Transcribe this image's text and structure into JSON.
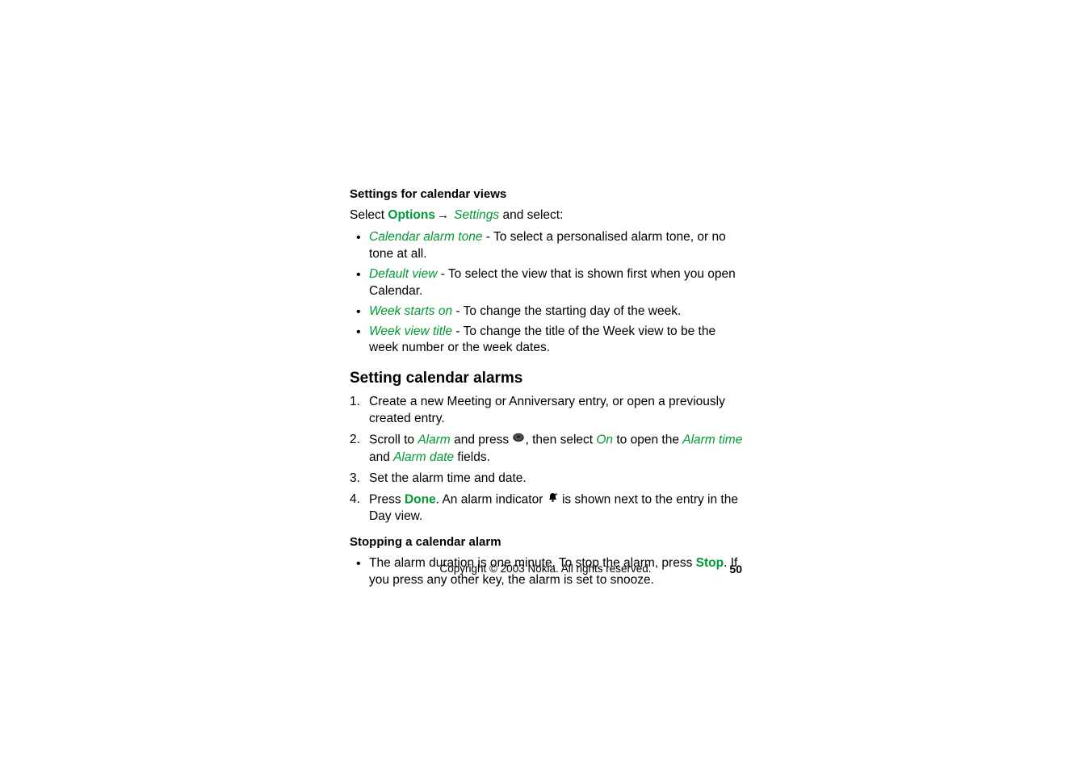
{
  "section1": {
    "heading": "Settings for calendar views",
    "select_prefix": "Select ",
    "options": "Options",
    "settings": "Settings",
    "and_select": " and select:",
    "items": [
      {
        "label": "Calendar alarm tone",
        "desc": " - To select a personalised alarm tone, or no tone at all."
      },
      {
        "label": "Default view",
        "desc": " - To select the view that is shown first when you open Calendar."
      },
      {
        "label": "Week starts on",
        "desc": " - To change the starting day of the week."
      },
      {
        "label": "Week view title",
        "desc": "  - To change the title of the Week view to be the week number or the week dates."
      }
    ]
  },
  "section2": {
    "heading": "Setting calendar alarms",
    "steps": {
      "s1": "Create a new Meeting or Anniversary entry, or open a previously created entry.",
      "s2_a": "Scroll to ",
      "s2_alarm": "Alarm",
      "s2_b": " and press ",
      "s2_c": ", then select ",
      "s2_on": "On",
      "s2_d": " to open the ",
      "s2_alarmtime": "Alarm time",
      "s2_e": " and ",
      "s2_alarmdate": "Alarm date",
      "s2_f": " fields.",
      "s3": "Set the alarm time and date.",
      "s4_a": "Press ",
      "s4_done": "Done",
      "s4_b": ". An alarm indicator ",
      "s4_c": " is shown next to the entry in the Day view."
    }
  },
  "section3": {
    "heading": "Stopping a calendar alarm",
    "bullet_a": "The alarm duration is one minute. To stop the alarm, press ",
    "bullet_stop": "Stop",
    "bullet_b": ". If you press any other key, the alarm is set to snooze."
  },
  "footer": "Copyright © 2003 Nokia. All rights reserved.",
  "page": "50"
}
